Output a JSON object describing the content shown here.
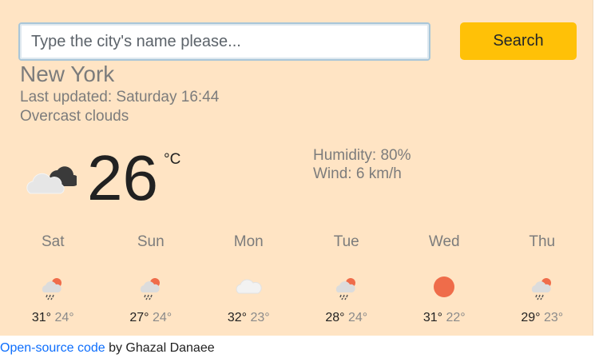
{
  "search": {
    "placeholder": "Type the city's name please...",
    "button_label": "Search"
  },
  "current": {
    "city": "New York",
    "last_updated": "Last updated: Saturday 16:44",
    "description": "Overcast clouds",
    "temperature": "26",
    "unit": "°C",
    "humidity": "Humidity: 80%",
    "wind": "Wind: 6 km/h",
    "icon": "overcast-clouds-icon"
  },
  "forecast": [
    {
      "day": "Sat",
      "max": "31°",
      "min": "24°",
      "icon": "rain-sun-icon"
    },
    {
      "day": "Sun",
      "max": "27°",
      "min": "24°",
      "icon": "rain-sun-icon"
    },
    {
      "day": "Mon",
      "max": "32°",
      "min": "23°",
      "icon": "cloud-icon"
    },
    {
      "day": "Tue",
      "max": "28°",
      "min": "24°",
      "icon": "rain-sun-icon"
    },
    {
      "day": "Wed",
      "max": "31°",
      "min": "22°",
      "icon": "sun-icon"
    },
    {
      "day": "Thu",
      "max": "29°",
      "min": "23°",
      "icon": "rain-sun-icon"
    }
  ],
  "footer": {
    "link_text": "Open-source code",
    "suffix": " by Ghazal Danaee"
  },
  "colors": {
    "background": "#ffe4c4",
    "button": "#ffc107",
    "link": "#0d6efd",
    "sun": "#ef6c4a"
  }
}
